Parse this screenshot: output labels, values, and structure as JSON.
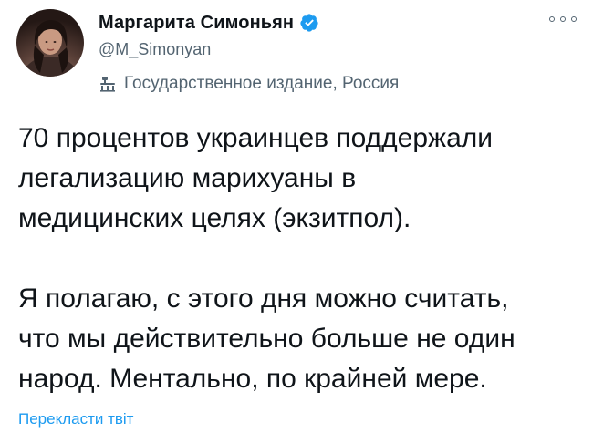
{
  "author": {
    "display_name": "Маргарита Симоньян",
    "handle": "@M_Simonyan",
    "verified": true,
    "label": "Государственное издание, Россия",
    "label_icon": "state-media-icon",
    "avatar_icon": "avatar"
  },
  "more_menu_icon": "more-options-icon",
  "tweet": {
    "paragraphs": [
      {
        "lines": [
          "70 процентов украинцев поддержали",
          "легализацию марихуаны в",
          "медицинских целях (экзитпол)."
        ]
      },
      {
        "lines": [
          "Я полагаю, с этого дня можно считать,",
          "что мы действительно больше не один",
          "народ. Ментально, по крайней мере."
        ]
      }
    ]
  },
  "translate_link": "Перекласти твіт",
  "colors": {
    "text": "#0f1419",
    "secondary": "#536471",
    "accent": "#1d9bf0"
  }
}
